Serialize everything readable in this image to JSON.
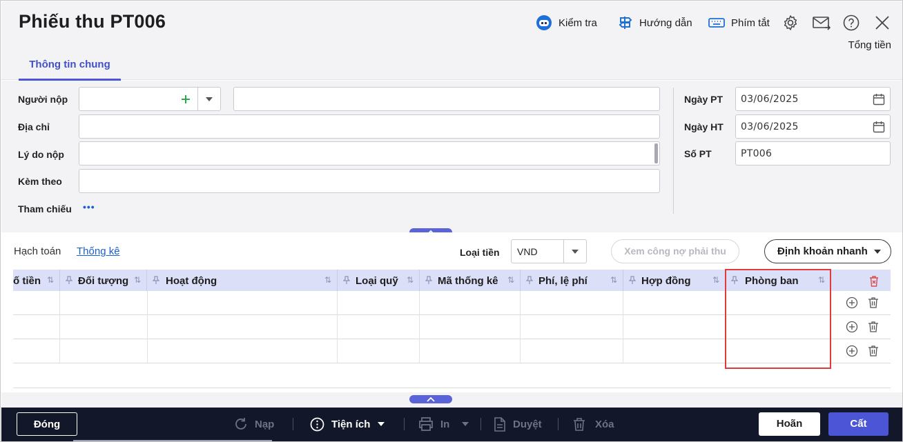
{
  "header": {
    "title": "Phiếu thu PT006",
    "tools": {
      "kiem_tra": "Kiểm tra",
      "huong_dan": "Hướng dẫn",
      "phim_tat": "Phím tắt"
    },
    "total_label": "Tổng tiền"
  },
  "tabs": {
    "thong_tin_chung": "Thông tin chung"
  },
  "form": {
    "nguoi_nop_label": "Người nộp",
    "nguoi_nop_value": "",
    "nguoi_nop_name": "",
    "dia_chi_label": "Địa chỉ",
    "dia_chi_value": "",
    "ly_do_label": "Lý do nộp",
    "ly_do_value": "",
    "kem_theo_label": "Kèm theo",
    "kem_theo_value": "",
    "tham_chieu_label": "Tham chiếu",
    "tham_chieu_more": "•••",
    "ngay_pt_label": "Ngày PT",
    "ngay_pt_value": "03/06/2025",
    "ngay_ht_label": "Ngày HT",
    "ngay_ht_value": "03/06/2025",
    "so_pt_label": "Số PT",
    "so_pt_value": "PT006"
  },
  "detail": {
    "tab_hach_toan": "Hạch toán",
    "tab_thong_ke": "Thống kê",
    "loai_tien_label": "Loại tiền",
    "loai_tien_value": "VND",
    "xem_cong_no": "Xem công nợ phải thu",
    "dinh_khoan": "Định khoản nhanh"
  },
  "grid": {
    "columns": [
      "ố tiền",
      "Đối tượng",
      "Hoạt động",
      "Loại quỹ",
      "Mã thống kê",
      "Phí, lệ phí",
      "Hợp đồng",
      "Phòng ban"
    ],
    "rows": [
      [
        "",
        "",
        "",
        "",
        "",
        "",
        "",
        ""
      ],
      [
        "",
        "",
        "",
        "",
        "",
        "",
        "",
        ""
      ],
      [
        "",
        "",
        "",
        "",
        "",
        "",
        "",
        ""
      ]
    ]
  },
  "footer": {
    "dong": "Đóng",
    "nap": "Nạp",
    "tien_ich": "Tiện ích",
    "in": "In",
    "duyet": "Duyệt",
    "xoa": "Xóa",
    "hoan": "Hoãn",
    "cat": "Cất"
  },
  "colors": {
    "accent": "#4b55d6",
    "footer_bg": "#121829",
    "header_row": "#dcdff8",
    "highlight": "#e03a3a"
  }
}
